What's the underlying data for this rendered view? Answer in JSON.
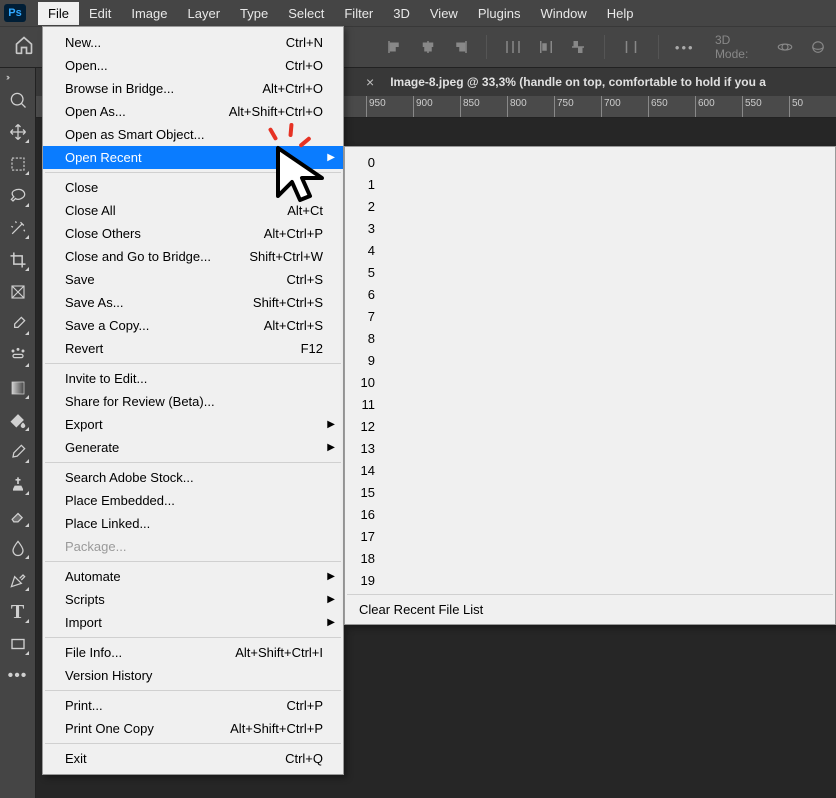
{
  "menubar": [
    "File",
    "Edit",
    "Image",
    "Layer",
    "Type",
    "Select",
    "Filter",
    "3D",
    "View",
    "Plugins",
    "Window",
    "Help"
  ],
  "options": {
    "mode3d": "3D Mode:"
  },
  "doc": {
    "title": "Image-8.jpeg @ 33,3% (handle on top, comfortable to hold if you a"
  },
  "ruler": [
    "950",
    "900",
    "850",
    "800",
    "750",
    "700",
    "650",
    "600",
    "550",
    "50"
  ],
  "file_menu": [
    {
      "label": "New...",
      "sc": "Ctrl+N"
    },
    {
      "label": "Open...",
      "sc": "Ctrl+O"
    },
    {
      "label": "Browse in Bridge...",
      "sc": "Alt+Ctrl+O"
    },
    {
      "label": "Open As...",
      "sc": "Alt+Shift+Ctrl+O"
    },
    {
      "label": "Open as Smart Object..."
    },
    {
      "label": "Open Recent",
      "submenu": true,
      "highlight": true
    },
    {
      "sep": true
    },
    {
      "label": "Close"
    },
    {
      "label": "Close All",
      "sc": "Alt+Ct"
    },
    {
      "label": "Close Others",
      "sc": "Alt+Ctrl+P"
    },
    {
      "label": "Close and Go to Bridge...",
      "sc": "Shift+Ctrl+W"
    },
    {
      "label": "Save",
      "sc": "Ctrl+S"
    },
    {
      "label": "Save As...",
      "sc": "Shift+Ctrl+S"
    },
    {
      "label": "Save a Copy...",
      "sc": "Alt+Ctrl+S"
    },
    {
      "label": "Revert",
      "sc": "F12"
    },
    {
      "sep": true
    },
    {
      "label": "Invite to Edit..."
    },
    {
      "label": "Share for Review (Beta)..."
    },
    {
      "label": "Export",
      "submenu": true
    },
    {
      "label": "Generate",
      "submenu": true
    },
    {
      "sep": true
    },
    {
      "label": "Search Adobe Stock..."
    },
    {
      "label": "Place Embedded..."
    },
    {
      "label": "Place Linked..."
    },
    {
      "label": "Package...",
      "disabled": true
    },
    {
      "sep": true
    },
    {
      "label": "Automate",
      "submenu": true
    },
    {
      "label": "Scripts",
      "submenu": true
    },
    {
      "label": "Import",
      "submenu": true
    },
    {
      "sep": true
    },
    {
      "label": "File Info...",
      "sc": "Alt+Shift+Ctrl+I"
    },
    {
      "label": "Version History"
    },
    {
      "sep": true
    },
    {
      "label": "Print...",
      "sc": "Ctrl+P"
    },
    {
      "label": "Print One Copy",
      "sc": "Alt+Shift+Ctrl+P"
    },
    {
      "sep": true
    },
    {
      "label": "Exit",
      "sc": "Ctrl+Q"
    }
  ],
  "recent_count": 20,
  "recent_clear": "Clear Recent File List"
}
